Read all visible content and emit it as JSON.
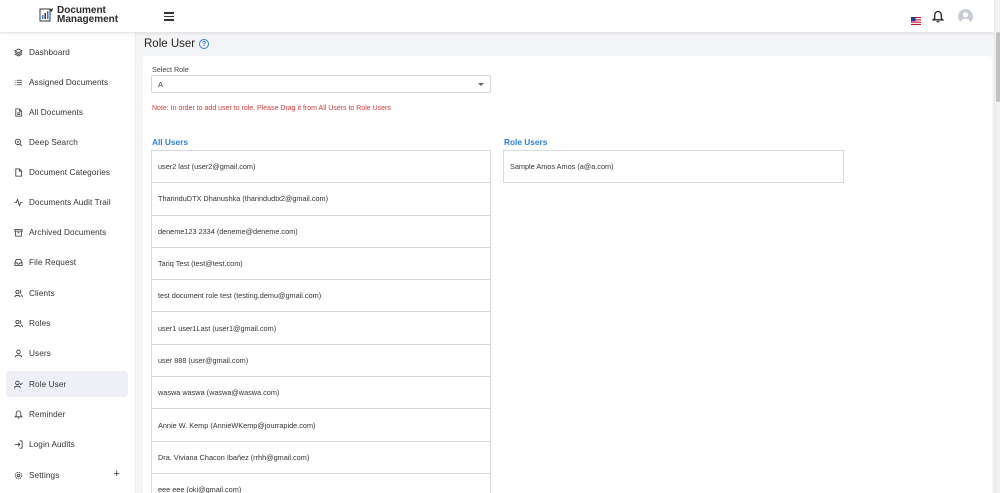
{
  "app": {
    "logo_line1": "Document",
    "logo_line2": "Management",
    "accent": "#2a7de1",
    "note_color": "#d13c3c"
  },
  "header": {
    "icons": [
      "menu-icon",
      "us-flag-icon",
      "bell-icon",
      "user-avatar-icon"
    ]
  },
  "sidebar": {
    "items": [
      {
        "label": "Dashboard",
        "icon": "dashboard-icon"
      },
      {
        "label": "Assigned Documents",
        "icon": "list-icon"
      },
      {
        "label": "All Documents",
        "icon": "file-icon"
      },
      {
        "label": "Deep Search",
        "icon": "search-icon"
      },
      {
        "label": "Document Categories",
        "icon": "file-icon"
      },
      {
        "label": "Documents Audit Trail",
        "icon": "activity-icon"
      },
      {
        "label": "Archived Documents",
        "icon": "archive-icon"
      },
      {
        "label": "File Request",
        "icon": "inbox-icon"
      },
      {
        "label": "Clients",
        "icon": "users-icon"
      },
      {
        "label": "Roles",
        "icon": "users-icon"
      },
      {
        "label": "Users",
        "icon": "user-icon"
      },
      {
        "label": "Role User",
        "icon": "user-check-icon",
        "active": true
      },
      {
        "label": "Reminder",
        "icon": "bell-icon"
      },
      {
        "label": "Login Audits",
        "icon": "login-icon"
      },
      {
        "label": "Settings",
        "icon": "gear-icon",
        "expand": "+"
      }
    ]
  },
  "main": {
    "title": "Role User",
    "help": "?",
    "select_label": "Select Role",
    "select_value": "A",
    "note": "Note: In order to add user to role. Please Drag it from All Users to Role Users",
    "all_users_title": "All Users",
    "role_users_title": "Role Users",
    "all_users": [
      "user2 last (user2@gmail.com)",
      "TharinduDTX Dhanushka (tharindudtx2@gmail.com)",
      "deneme123 2334 (deneme@deneme.com)",
      "Tariq Test (test@test.com)",
      "test document role test (testing.demu@gmail.com)",
      "user1 user1Last (user1@gmail.com)",
      "user 888 (user@gmail.com)",
      "waswa waswa (waswa@waswa.com)",
      "Annie W. Kemp (AnnieWKemp@jourrapide.com)",
      "Dra. Viviana Chacon Ibañez (rrhh@gmail.com)",
      "eee eee (oki@gmail.com)"
    ],
    "role_users": [
      "Sample Amos Amos (a@a.com)"
    ]
  }
}
